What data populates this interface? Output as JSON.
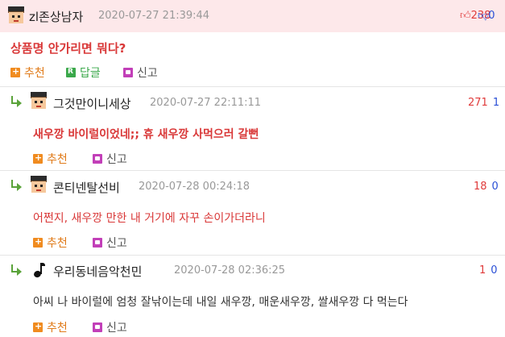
{
  "post": {
    "nickname": "zl존상남자",
    "datetime": "2020-07-27 21:39:44",
    "upvotes": "238",
    "downvotes": "0",
    "title": "상품명 안가리면 뭐다?",
    "actions": {
      "recommend": "추천",
      "reply": "답글",
      "report": "신고"
    }
  },
  "comments": [
    {
      "nickname": "그것만이니세상",
      "datetime": "2020-07-27 22:11:11",
      "up": "271",
      "down": "1",
      "text": "새우깡 바이럴이었네;; 휴 새우깡 사먹으러 갈뻔",
      "actions": {
        "recommend": "추천",
        "report": "신고"
      },
      "icon": "avatar-icon"
    },
    {
      "nickname": "콘티넨탈선비",
      "datetime": "2020-07-28 00:24:18",
      "up": "18",
      "down": "0",
      "text": "어쩐지, 새우깡 만한 내 거기에 자꾸 손이가더라니",
      "actions": {
        "recommend": "추천",
        "report": "신고"
      },
      "icon": "avatar-icon"
    },
    {
      "nickname": "우리동네음악천민",
      "datetime": "2020-07-28 02:36:25",
      "up": "1",
      "down": "0",
      "text": "아씨 나 바이럴에 엄청 잘낚이는데 내일 새우깡, 매운새우깡, 쌀새우깡 다 먹는다",
      "actions": {
        "recommend": "추천",
        "report": "신고"
      },
      "icon": "music-note-icon"
    }
  ],
  "colors": {
    "accent_red": "#d93838",
    "accent_blue": "#2a4fd6",
    "header_bg": "#fde8ea",
    "reply_green": "#5aa33a"
  }
}
